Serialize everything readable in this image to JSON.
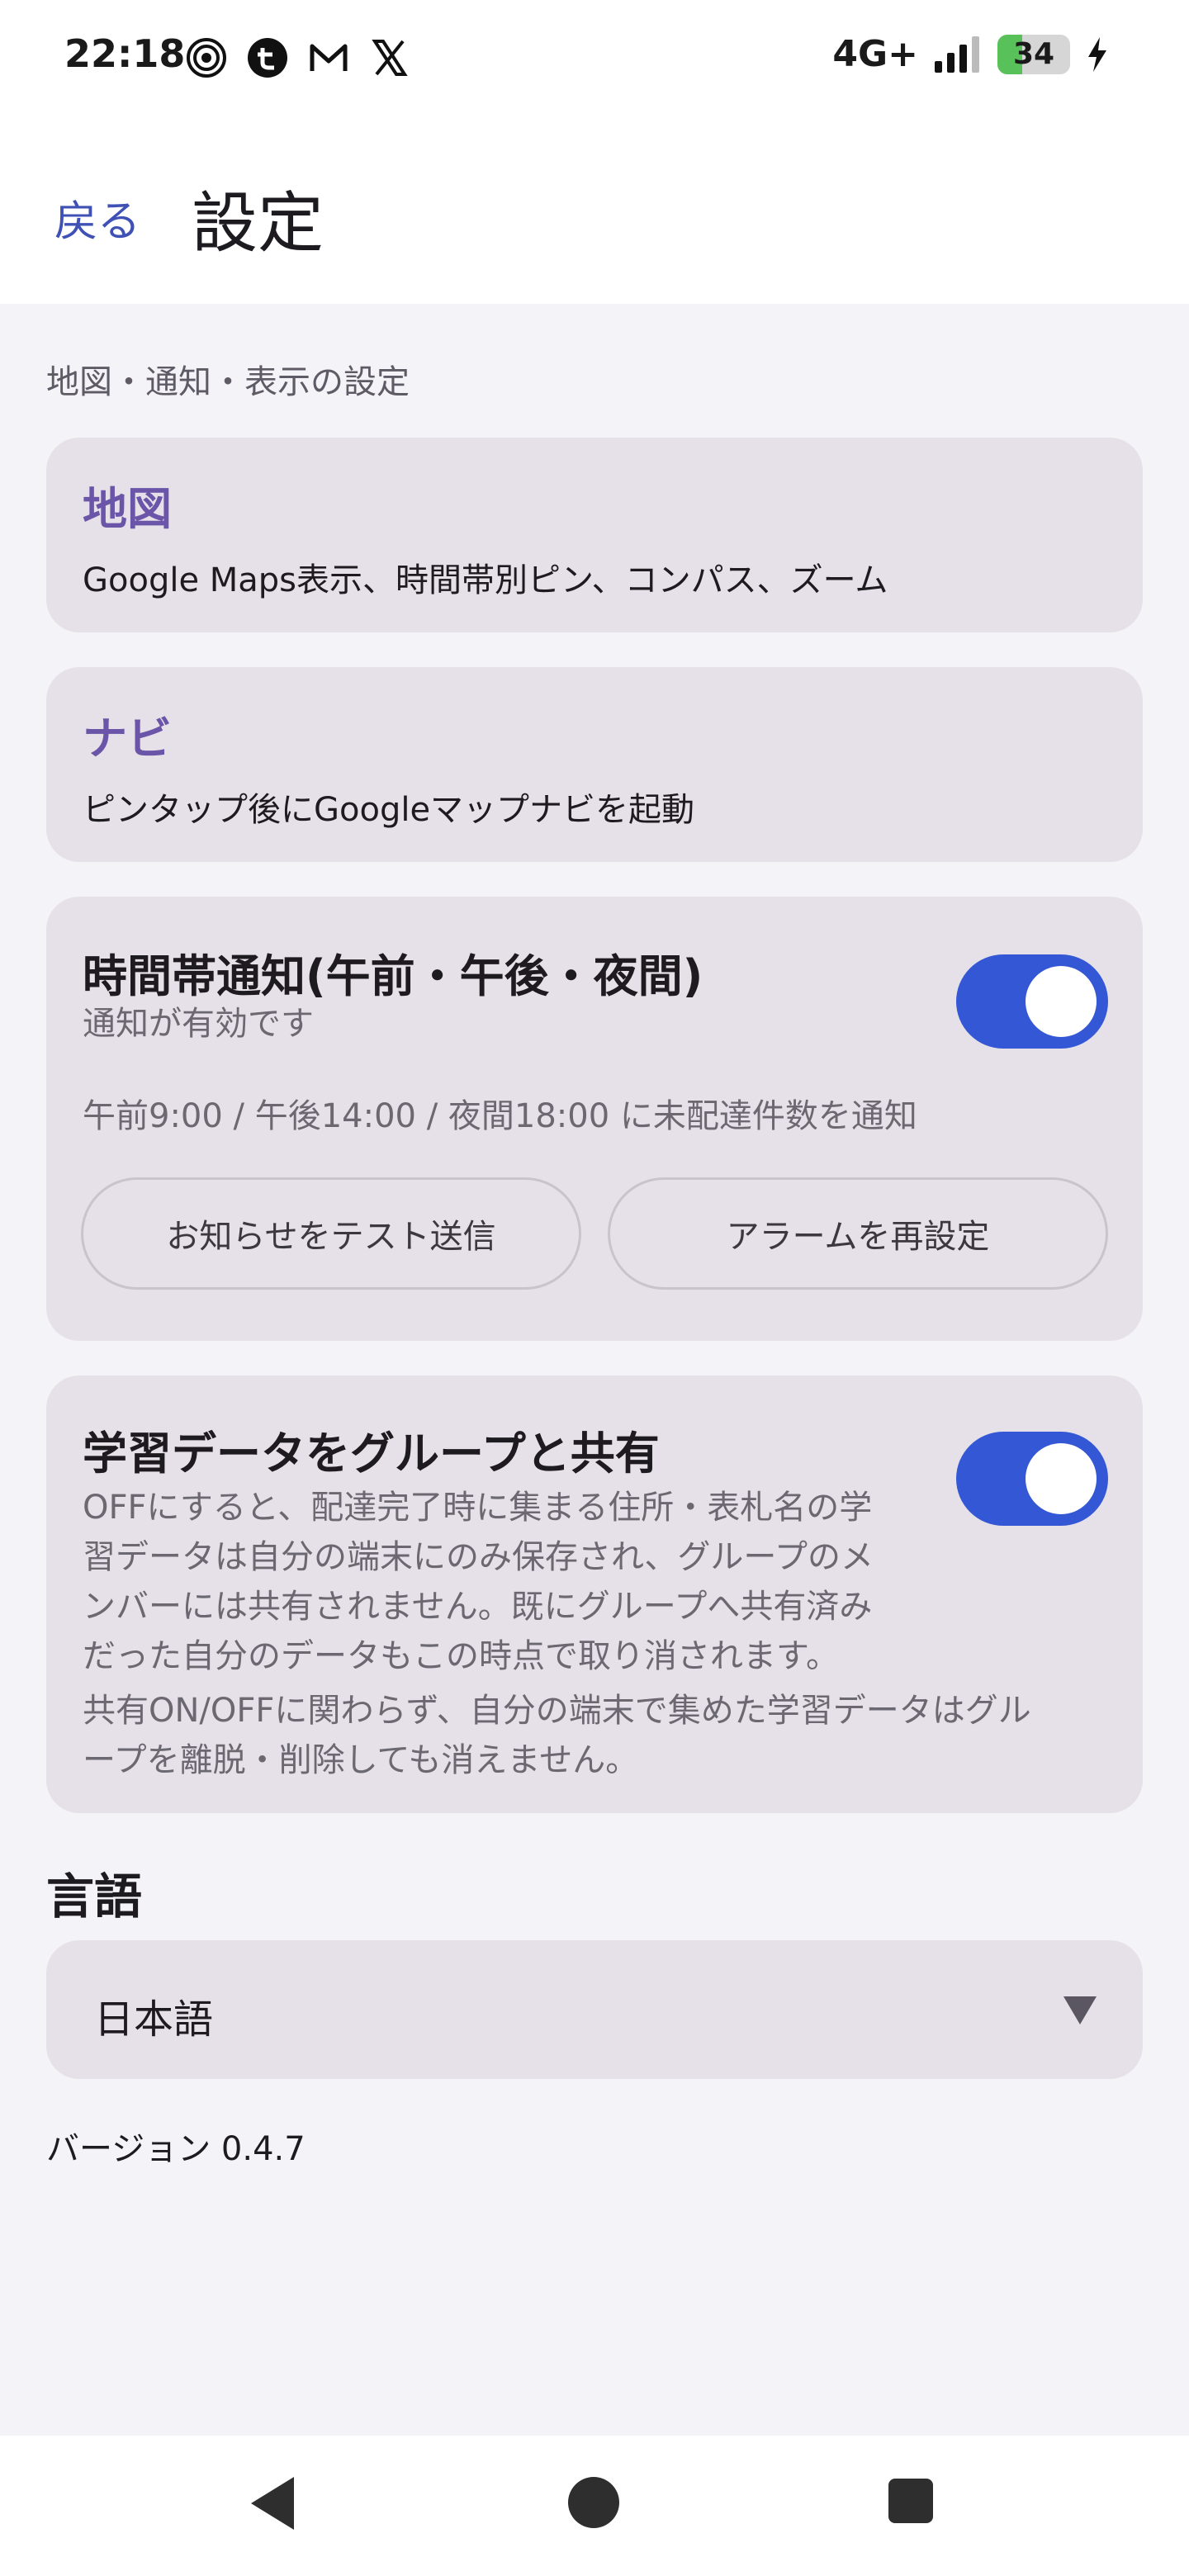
{
  "status_bar": {
    "time": "22:18",
    "left_icons": [
      "spiral-app-icon",
      "t-app-icon",
      "gmail-icon",
      "x-icon"
    ],
    "network": "4G+",
    "battery_level": "34",
    "battery_percent": 34,
    "charging": true
  },
  "header": {
    "back_label": "戻る",
    "title": "設定"
  },
  "main": {
    "caption": "地図・通知・表示の設定",
    "map_card": {
      "title": "地図",
      "description": "Google Maps表示、時間帯別ピン、コンパス、ズーム"
    },
    "navi_card": {
      "title": "ナビ",
      "description": "ピンタップ後にGoogleマップナビを起動"
    },
    "notification_card": {
      "title": "時間帯通知(午前・午後・夜間)",
      "status": "通知が有効です",
      "toggle_on": true,
      "schedule": "午前9:00 / 午後14:00 / 夜間18:00 に未配達件数を通知",
      "test_button": "お知らせをテスト送信",
      "alarm_button": "アラームを再設定"
    },
    "sharing_card": {
      "title": "学習データをグループと共有",
      "toggle_on": true,
      "description": [
        "OFFにすると、配達完了時に集まる住所・表札名の学",
        "習データは自分の端末にのみ保存され、グループのメ",
        "ンバーには共有されません。既にグループへ共有済み",
        "だった自分のデータもこの時点で取り消されます。"
      ],
      "note": [
        "共有ON/OFFに関わらず、自分の端末で集めた学習データはグル",
        "ープを離脱・削除しても消えません。"
      ]
    },
    "language": {
      "heading": "言語",
      "selected": "日本語"
    },
    "version": "バージョン 0.4.7"
  },
  "colors": {
    "accent": "#3457d5",
    "card_title": "#6a55a8",
    "link": "#3f51b5",
    "card_bg": "#e6e1e8",
    "page_bg": "#f4f3f7"
  }
}
